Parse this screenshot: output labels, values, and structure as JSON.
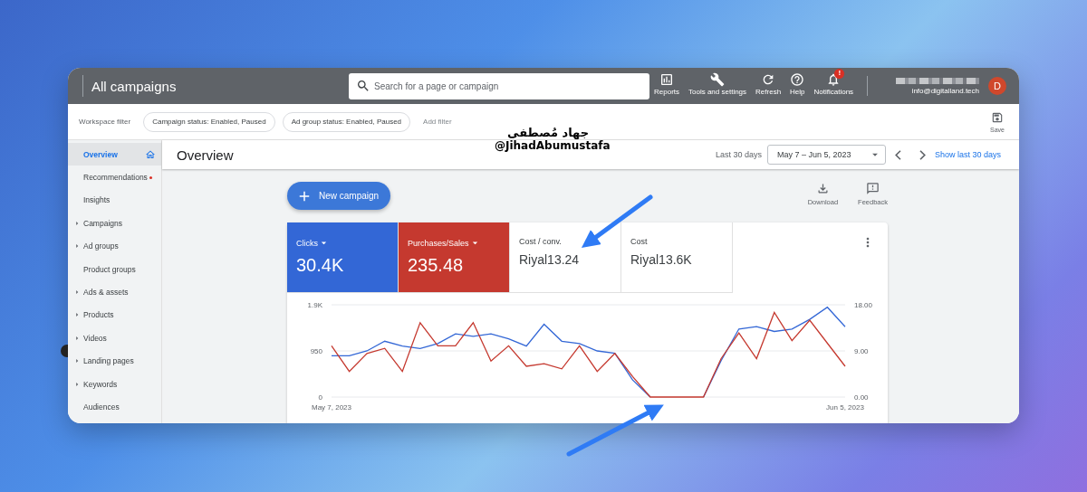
{
  "header": {
    "title": "All campaigns",
    "search": {
      "placeholder": "Search for a page or campaign"
    },
    "actions": [
      {
        "label": "Reports",
        "kind": "reports"
      },
      {
        "label": "Tools and settings",
        "kind": "tools"
      },
      {
        "label": "Refresh",
        "kind": "refresh"
      },
      {
        "label": "Help",
        "kind": "help"
      },
      {
        "label": "Notifications",
        "kind": "notifications",
        "badge": "!"
      }
    ],
    "account": {
      "email": "info@digitalland.tech",
      "avatar": "D"
    }
  },
  "filter_bar": {
    "label": "Workspace filter",
    "chips": [
      "Campaign status: Enabled, Paused",
      "Ad group status: Enabled, Paused"
    ],
    "add_filter": "Add filter",
    "save": "Save"
  },
  "sidebar": {
    "items": [
      {
        "label": "Overview",
        "selected": true,
        "expandable": false,
        "kind": "home"
      },
      {
        "label": "Recommendations",
        "selected": false,
        "expandable": false,
        "kind": "dot"
      },
      {
        "label": "Insights",
        "selected": false,
        "expandable": false,
        "kind": "plain"
      },
      {
        "label": "Campaigns",
        "selected": false,
        "expandable": true,
        "kind": "plain"
      },
      {
        "label": "Ad groups",
        "selected": false,
        "expandable": true,
        "kind": "plain"
      },
      {
        "label": "Product groups",
        "selected": false,
        "expandable": false,
        "kind": "plain"
      },
      {
        "label": "Ads & assets",
        "selected": false,
        "expandable": true,
        "kind": "plain"
      },
      {
        "label": "Products",
        "selected": false,
        "expandable": true,
        "kind": "plain"
      },
      {
        "label": "Videos",
        "selected": false,
        "expandable": true,
        "kind": "plain"
      },
      {
        "label": "Landing pages",
        "selected": false,
        "expandable": true,
        "kind": "plain"
      },
      {
        "label": "Keywords",
        "selected": false,
        "expandable": true,
        "kind": "plain"
      },
      {
        "label": "Audiences",
        "selected": false,
        "expandable": false,
        "kind": "plain"
      }
    ]
  },
  "overview": {
    "title": "Overview",
    "date_range": {
      "preset": "Last 30 days",
      "value": "May 7 – Jun 5, 2023",
      "show_last": "Show last 30 days"
    },
    "new_campaign": "New campaign",
    "tools": [
      {
        "label": "Download",
        "kind": "download"
      },
      {
        "label": "Feedback",
        "kind": "feedback"
      }
    ],
    "metrics": [
      {
        "value": "30.4K",
        "selected": true,
        "color": "#3367d6"
      },
      {
        "value": "235.48",
        "selected": true,
        "color": "#c5392f"
      },
      {
        "label": "Cost / conv.",
        "value": "Riyal13.24",
        "selected": false
      },
      {
        "label": "Cost",
        "value": "Riyal13.6K",
        "selected": false
      }
    ],
    "chart_data": {
      "type": "line",
      "ylim": [
        0,
        1900
      ],
      "y2lim": [
        0,
        18
      ],
      "categories": [
        "May 7, 2023",
        null,
        null,
        null,
        null,
        null,
        null,
        null,
        null,
        null,
        null,
        null,
        null,
        null,
        null,
        null,
        null,
        null,
        null,
        null,
        null,
        null,
        null,
        null,
        null,
        null,
        null,
        null,
        null,
        "Jun 5, 2023"
      ],
      "yticks": [
        0,
        950,
        {
          "value": 1900,
          "label": "1.9K"
        }
      ],
      "y2ticks": [
        {
          "value": 0,
          "label": "0.00"
        },
        {
          "value": 9,
          "label": "9.00"
        },
        {
          "value": 18,
          "label": "18.00"
        }
      ],
      "series": [
        {
          "name": "Clicks",
          "color": "#3367d6",
          "values": [
            850,
            850,
            950,
            1150,
            1050,
            1000,
            1100,
            1300,
            1250,
            1300,
            1200,
            1050,
            1500,
            1150,
            1100,
            950,
            900,
            350,
            0,
            null,
            null,
            0,
            750,
            1400,
            1450,
            1350,
            1400,
            1600,
            1850,
            1450
          ]
        },
        {
          "name": "Purchases/Sales",
          "color": "#c5392f",
          "axis": "y2",
          "values": [
            10,
            5,
            8.5,
            9.5,
            5,
            14.5,
            10,
            10,
            14.5,
            7,
            10,
            6,
            6.5,
            5.5,
            10,
            5,
            8.5,
            4,
            0,
            0,
            0,
            0,
            7.5,
            12.5,
            7.5,
            16.5,
            11,
            15,
            10.5,
            6
          ]
        }
      ]
    }
  },
  "annotation": {
    "name": "جهاد مُصطفى",
    "handle": "@JihadAbumustafa"
  }
}
